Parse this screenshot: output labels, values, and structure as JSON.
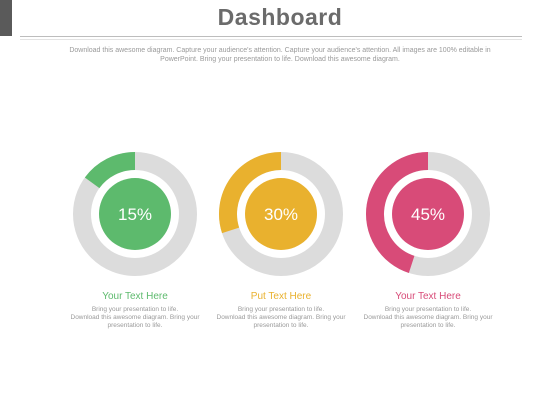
{
  "header": {
    "title": "Dashboard",
    "intro": "Download this awesome diagram. Capture your audience's attention. Capture your audience's attention. All images are 100% editable in PowerPoint. Bring your presentation to life. Download this awesome diagram."
  },
  "cards": [
    {
      "percent_label": "15%",
      "fraction": 0.15,
      "color": "#5dba6d",
      "title": "Your Text Here",
      "line1": "Bring your presentation to life.",
      "line2": "Download this awesome diagram. Bring your presentation to life."
    },
    {
      "percent_label": "30%",
      "fraction": 0.3,
      "color": "#e9b12e",
      "title": "Put Text Here",
      "line1": "Bring your presentation to life.",
      "line2": "Download this awesome diagram. Bring your presentation to life."
    },
    {
      "percent_label": "45%",
      "fraction": 0.45,
      "color": "#d84b78",
      "title": "Your Text Here",
      "line1": "Bring your presentation to life.",
      "line2": "Download this awesome diagram. Bring your presentation to life."
    }
  ],
  "colors": {
    "track": "#dcdcdc",
    "title": "#6b6b6b",
    "body_text": "#9a9a9a"
  }
}
